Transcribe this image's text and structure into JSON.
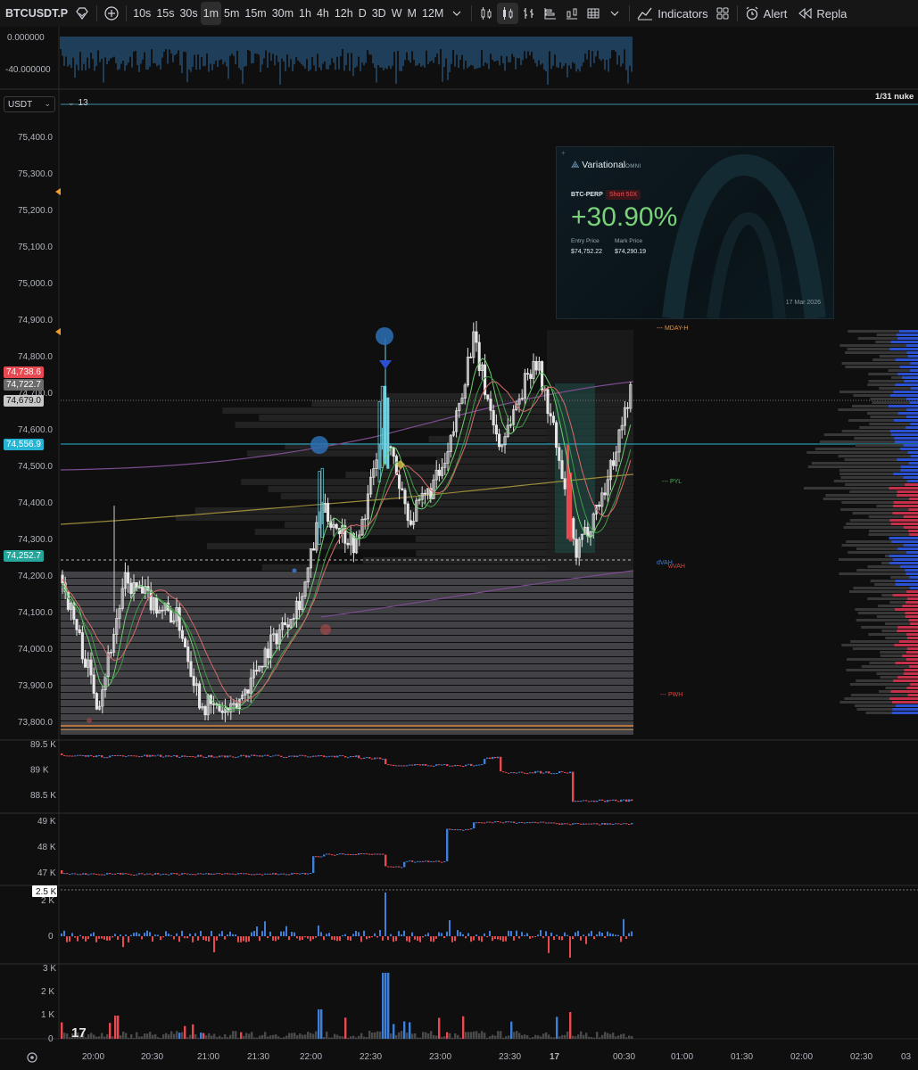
{
  "toolbar": {
    "symbol": "BTCUSDT.P",
    "intervals": [
      "10s",
      "15s",
      "30s",
      "1m",
      "5m",
      "15m",
      "30m",
      "1h",
      "4h",
      "12h",
      "D",
      "3D",
      "W",
      "M",
      "12M"
    ],
    "active_interval": "1m",
    "indicators_label": "Indicators",
    "alert_label": "Alert",
    "replay_label": "Repla"
  },
  "top_pane": {
    "ticks": [
      "0.000000",
      "-40.000000"
    ]
  },
  "header_row": {
    "currency": "USDT",
    "count": "13",
    "note": "1/31 nuke"
  },
  "price_axis": {
    "ticks": [
      "75,400.0",
      "75,300.0",
      "75,200.0",
      "75,100.0",
      "75,000.0",
      "74,900.0",
      "74,800.0",
      "74,700.0",
      "74,600.0",
      "74,500.0",
      "74,400.0",
      "74,300.0",
      "74,200.0",
      "74,100.0",
      "74,000.0",
      "73,900.0",
      "73,800.0"
    ],
    "labels": [
      {
        "text": "74,738.6",
        "color": "#e8484f"
      },
      {
        "text": "74,722.7",
        "color": "#6b6b6b"
      },
      {
        "text": "74,679.0",
        "color": "#c8c8c8"
      },
      {
        "text": "74,556.9",
        "color": "#27b4d4"
      },
      {
        "text": "74,252.7",
        "color": "#26a69a"
      }
    ]
  },
  "level_labels": [
    {
      "text": "MDAY-H",
      "color": "#e8903a"
    },
    {
      "text": "PYL",
      "color": "#4caf50"
    },
    {
      "text": "dVAH",
      "color": "#3f7fd9"
    },
    {
      "text": "wVAH",
      "color": "#d9443b"
    },
    {
      "text": "PWH",
      "color": "#d9443b"
    }
  ],
  "position_card": {
    "brand": "Variational",
    "brand_suffix": "OMNI",
    "pair": "BTC-PERP",
    "side": "Short  50X",
    "pnl": "+30.90%",
    "entry_label": "Entry Price",
    "entry_value": "$74,752.22",
    "mark_label": "Mark Price",
    "mark_value": "$74,290.19",
    "date": "17 Mar 2026"
  },
  "pane1": {
    "ticks": [
      "89.5 K",
      "89 K",
      "88.5 K"
    ]
  },
  "pane2": {
    "ticks": [
      "49 K",
      "48 K",
      "47 K"
    ]
  },
  "pane3": {
    "ticks": [
      "2.5 K",
      "2 K",
      "0"
    ]
  },
  "pane4": {
    "ticks": [
      "3 K",
      "2 K",
      "1 K",
      "0"
    ]
  },
  "time_axis": {
    "ticks": [
      "20:00",
      "20:30",
      "21:00",
      "21:30",
      "22:00",
      "22:30",
      "23:00",
      "23:30",
      "17",
      "00:30",
      "01:00",
      "01:30",
      "02:00",
      "02:30",
      "03"
    ]
  },
  "colors": {
    "up": "#e0e0e0",
    "down": "#e0e0e0",
    "accent_blue": "#2962ff",
    "cyan": "#26c6da",
    "red": "#ef5350"
  }
}
